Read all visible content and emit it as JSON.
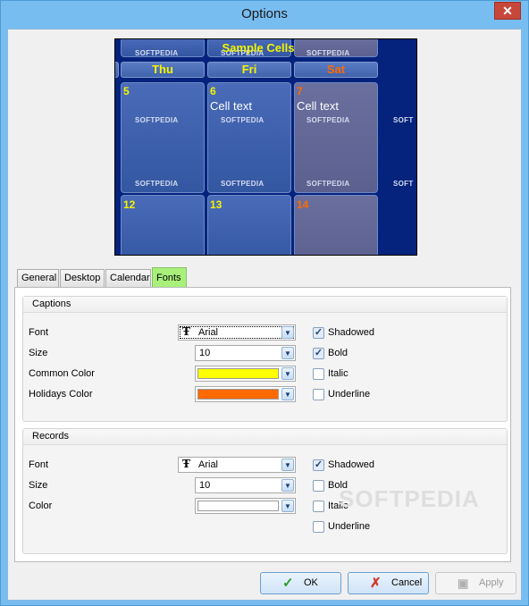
{
  "window": {
    "title": "Options",
    "close_glyph": "✕"
  },
  "preview": {
    "title": "Sample Cells",
    "watermark": "SOFTPEDIA",
    "watermark_partial": "SOFT",
    "days": [
      "Thu",
      "Fri",
      "Sat"
    ],
    "dates": [
      "5",
      "6",
      "7",
      "12",
      "13",
      "14"
    ],
    "cell_text": "Cell text",
    "colors": {
      "background": "#05237c",
      "caption": "#f4f400",
      "holiday": "#ff6a00"
    }
  },
  "tabs": [
    {
      "label": "General"
    },
    {
      "label": "Desktop"
    },
    {
      "label": "Calendar"
    },
    {
      "label": "Fonts",
      "active": true
    }
  ],
  "captions": {
    "header": "Captions",
    "font_label": "Font",
    "font_value": "Arial",
    "size_label": "Size",
    "size_value": "10",
    "common_color_label": "Common Color",
    "common_color": "#ffff00",
    "holidays_color_label": "Holidays Color",
    "holidays_color": "#ff6a00",
    "shadowed": {
      "label": "Shadowed",
      "checked": true
    },
    "bold": {
      "label": "Bold",
      "checked": true
    },
    "italic": {
      "label": "Italic",
      "checked": false
    },
    "underline": {
      "label": "Underline",
      "checked": false
    }
  },
  "records": {
    "header": "Records",
    "font_label": "Font",
    "font_value": "Arial",
    "size_label": "Size",
    "size_value": "10",
    "color_label": "Color",
    "color": "#ffffff",
    "shadowed": {
      "label": "Shadowed",
      "checked": true
    },
    "bold": {
      "label": "Bold",
      "checked": false
    },
    "italic": {
      "label": "Italic",
      "checked": false
    },
    "underline": {
      "label": "Underline",
      "checked": false
    }
  },
  "buttons": {
    "ok": "OK",
    "cancel": "Cancel",
    "apply": "Apply"
  },
  "icons": {
    "font_type": "font-type-icon",
    "dropdown": "chevron-down-icon",
    "check": "checkmark-icon"
  },
  "watermark": "SOFTPEDIA"
}
